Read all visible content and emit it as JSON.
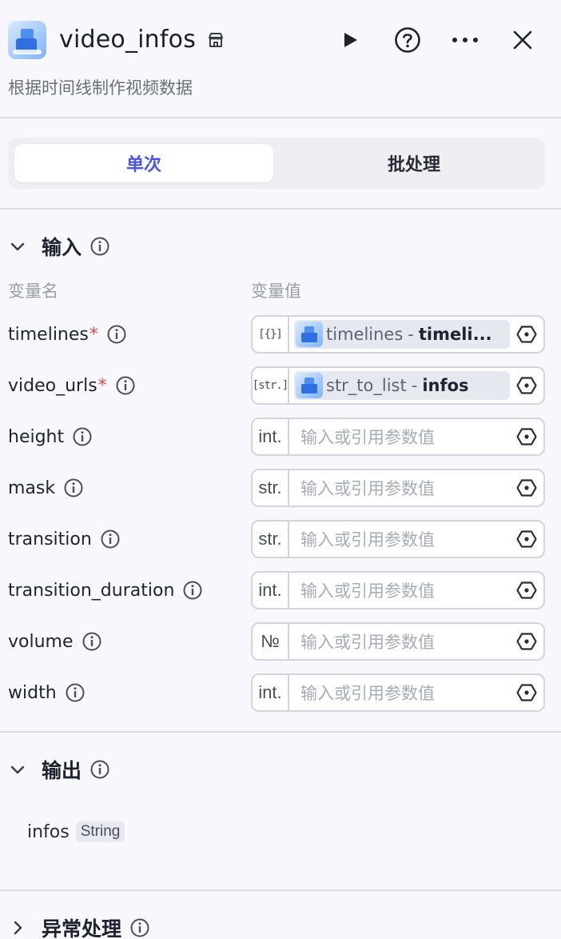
{
  "header": {
    "title": "video_infos",
    "subtitle": "根据时间线制作视频数据"
  },
  "mode_tabs": {
    "single": "单次",
    "batch": "批处理",
    "active": "single"
  },
  "input": {
    "section_title": "输入",
    "col_name": "变量名",
    "col_value": "变量值",
    "params": [
      {
        "name": "timelines",
        "required": true,
        "type": "[{}]",
        "ref_node": "timelines",
        "ref_sep": "-",
        "ref_var": "timeli..."
      },
      {
        "name": "video_urls",
        "required": true,
        "type": "[str.]",
        "ref_node": "str_to_list",
        "ref_sep": "-",
        "ref_var": "infos"
      },
      {
        "name": "height",
        "required": false,
        "type": "int.",
        "placeholder": "输入或引用参数值"
      },
      {
        "name": "mask",
        "required": false,
        "type": "str.",
        "placeholder": "输入或引用参数值"
      },
      {
        "name": "transition",
        "required": false,
        "type": "str.",
        "placeholder": "输入或引用参数值"
      },
      {
        "name": "transition_duration",
        "required": false,
        "type": "int.",
        "placeholder": "输入或引用参数值"
      },
      {
        "name": "volume",
        "required": false,
        "type": "№",
        "placeholder": "输入或引用参数值"
      },
      {
        "name": "width",
        "required": false,
        "type": "int.",
        "placeholder": "输入或引用参数值"
      }
    ],
    "required_mark": "*"
  },
  "output": {
    "section_title": "输出",
    "items": [
      {
        "name": "infos",
        "type": "String"
      }
    ]
  },
  "error_handling": {
    "section_title": "异常处理"
  },
  "colors": {
    "accent": "#4d53e8",
    "required": "#e5484d"
  },
  "icons": [
    "store-icon",
    "run-icon",
    "help-icon",
    "more-icon",
    "close-icon",
    "chevron-down-icon",
    "chevron-right-icon",
    "info-icon",
    "variable-select-icon"
  ]
}
